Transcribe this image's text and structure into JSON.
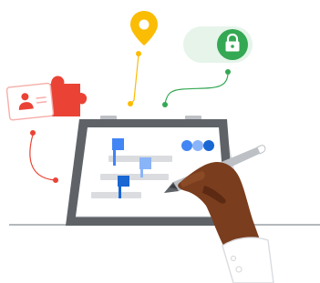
{
  "colors": {
    "blue": "#4285F4",
    "blue_dark": "#1967D2",
    "blue_light": "#8AB4F8",
    "red": "#EA4335",
    "yellow": "#FBBC04",
    "green": "#34A853",
    "green_light": "#E6F4EA",
    "gray_dark": "#5F6368",
    "gray_mid": "#9AA0A6",
    "gray_light": "#DADCE0",
    "skin": "#7A3D1E",
    "skin_shadow": "#5C2A12"
  },
  "icons": [
    "map-pin-icon",
    "lock-icon",
    "user-icon",
    "puzzle-piece-icon",
    "laptop-illustration",
    "stylus-icon",
    "hand-illustration"
  ]
}
